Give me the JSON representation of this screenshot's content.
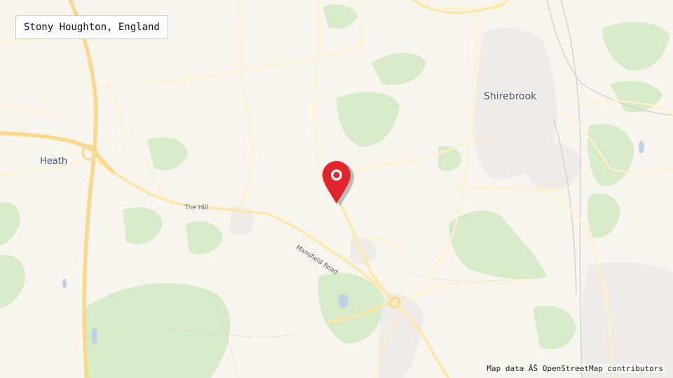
{
  "location": {
    "title": "Stony Houghton, England"
  },
  "places": {
    "shirebrook": "Shirebrook",
    "heath": "Heath",
    "the_hill": "The Hill",
    "mansfield_road": "Mansfield Road"
  },
  "map": {
    "attribution": "Map data ÂŠ OpenStreetMap contributors",
    "marker_icon": "map-pin-icon",
    "colors": {
      "background": "#f8f4ee",
      "woodland": "#d7ebc8",
      "motorway": "#fbd88a",
      "road": "#fff2c6",
      "marker": "#e1252b"
    }
  }
}
